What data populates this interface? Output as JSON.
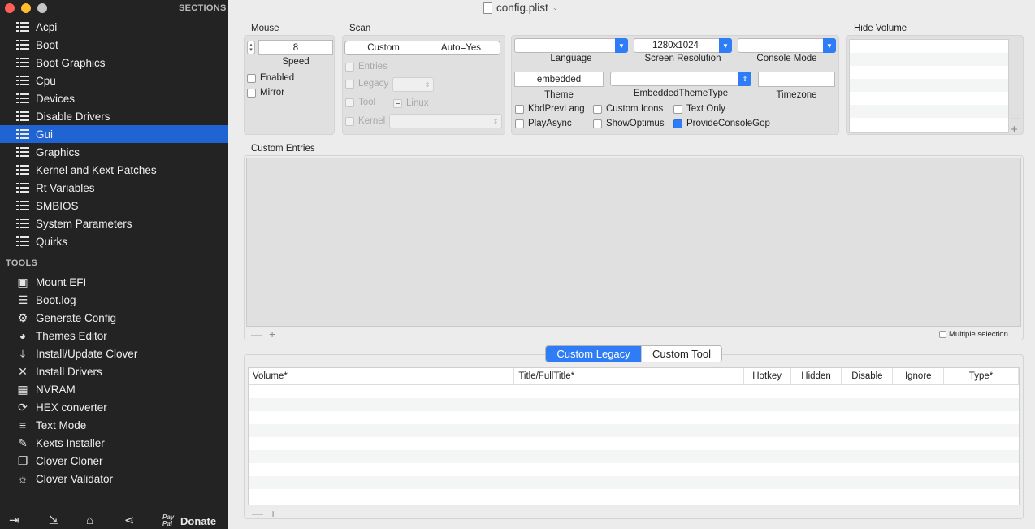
{
  "window": {
    "title": "config.plist"
  },
  "sidebar": {
    "sections_header": "SECTIONS",
    "sections": [
      {
        "label": "Acpi"
      },
      {
        "label": "Boot"
      },
      {
        "label": "Boot Graphics"
      },
      {
        "label": "Cpu"
      },
      {
        "label": "Devices"
      },
      {
        "label": "Disable Drivers"
      },
      {
        "label": "Gui"
      },
      {
        "label": "Graphics"
      },
      {
        "label": "Kernel and Kext Patches"
      },
      {
        "label": "Rt Variables"
      },
      {
        "label": "SMBIOS"
      },
      {
        "label": "System Parameters"
      },
      {
        "label": "Quirks"
      }
    ],
    "active_section": "Gui",
    "tools_header": "TOOLS",
    "tools": [
      {
        "label": "Mount EFI",
        "icon": "disk-icon"
      },
      {
        "label": "Boot.log",
        "icon": "log-search-icon"
      },
      {
        "label": "Generate Config",
        "icon": "gears-icon"
      },
      {
        "label": "Themes Editor",
        "icon": "palette-icon"
      },
      {
        "label": "Install/Update Clover",
        "icon": "download-icon"
      },
      {
        "label": "Install Drivers",
        "icon": "tools-icon"
      },
      {
        "label": "NVRAM",
        "icon": "chip-icon"
      },
      {
        "label": "HEX converter",
        "icon": "convert-icon"
      },
      {
        "label": "Text Mode",
        "icon": "text-lines-icon"
      },
      {
        "label": "Kexts Installer",
        "icon": "kext-icon"
      },
      {
        "label": "Clover Cloner",
        "icon": "clone-icon"
      },
      {
        "label": "Clover Validator",
        "icon": "bulb-icon"
      }
    ],
    "bottom": {
      "donate_prefix": "Pay Pal",
      "donate_label": "Donate"
    }
  },
  "mouse": {
    "header": "Mouse",
    "speed_value": "8",
    "speed_label": "Speed",
    "enabled_label": "Enabled",
    "mirror_label": "Mirror"
  },
  "scan": {
    "header": "Scan",
    "segments": [
      "Custom",
      "Auto=Yes"
    ],
    "entries_label": "Entries",
    "legacy_label": "Legacy",
    "tool_label": "Tool",
    "linux_label": "Linux",
    "kernel_label": "Kernel"
  },
  "display": {
    "language_label": "Language",
    "language_value": "",
    "resolution_label": "Screen Resolution",
    "resolution_value": "1280x1024",
    "console_label": "Console Mode",
    "console_value": "",
    "theme_value": "embedded",
    "theme_label": "Theme",
    "embedded_theme_type_label": "EmbeddedThemeType",
    "embedded_theme_type_value": "",
    "timezone_label": "Timezone",
    "timezone_value": "",
    "checks": {
      "kbd_prev_lang": "KbdPrevLang",
      "custom_icons": "Custom Icons",
      "text_only": "Text Only",
      "play_async": "PlayAsync",
      "show_optimus": "ShowOptimus",
      "provide_console_gop": "ProvideConsoleGop"
    }
  },
  "hide_volume": {
    "header": "Hide Volume"
  },
  "custom_entries": {
    "header": "Custom Entries",
    "multiple_selection": "Multiple selection"
  },
  "tabs": [
    "Custom Legacy",
    "Custom Tool"
  ],
  "active_tab": "Custom Legacy",
  "table": {
    "columns": [
      "Volume*",
      "Title/FullTitle*",
      "Hotkey",
      "Hidden",
      "Disable",
      "Ignore",
      "Type*"
    ]
  },
  "colors": {
    "accent": "#2e7cf6",
    "sidebar_bg": "#232323",
    "sidebar_active": "#1f64d2"
  }
}
